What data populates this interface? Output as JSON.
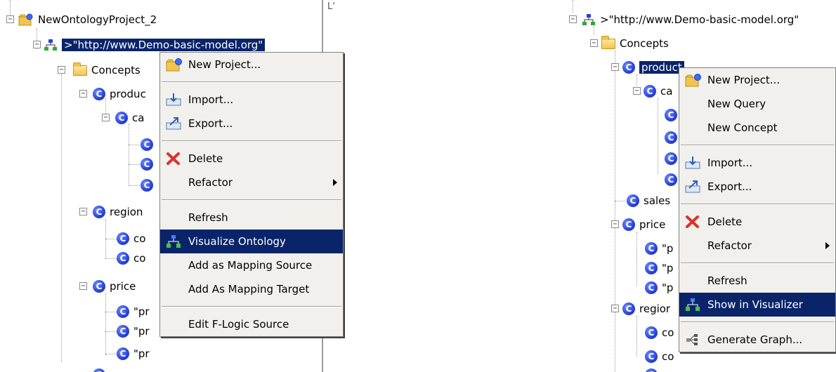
{
  "left": {
    "tree": {
      "project": "NewOntologyProject_2",
      "ontology": ">\"http://www.Demo-basic-model.org\"",
      "concepts": "Concepts",
      "items": [
        "produc",
        "ca",
        "region",
        "co",
        "co",
        "price",
        "\"pr",
        "\"pr",
        "\"pr"
      ]
    },
    "side_label": "L‘",
    "menu": {
      "new_project": "New Project...",
      "import": "Import...",
      "export": "Export...",
      "delete": "Delete",
      "refactor": "Refactor",
      "refresh": "Refresh",
      "visualize": "Visualize Ontology",
      "add_source": "Add as Mapping Source",
      "add_target": "Add As Mapping Target",
      "edit_flogic": "Edit F-Logic Source"
    }
  },
  "right": {
    "tree": {
      "ontology": ">\"http://www.Demo-basic-model.org\"",
      "concepts": "Concepts",
      "product": "product",
      "items": [
        "ca",
        "sales",
        "price",
        "\"p",
        "\"p",
        "\"p",
        "regior",
        "co",
        "co"
      ]
    },
    "menu": {
      "new_project": "New Project...",
      "new_query": "New Query",
      "new_concept": "New Concept",
      "import": "Import...",
      "export": "Export...",
      "delete": "Delete",
      "refactor": "Refactor",
      "refresh": "Refresh",
      "show_visualizer": "Show in Visualizer",
      "generate_graph": "Generate Graph..."
    }
  },
  "colors": {
    "selection": "#0a246a",
    "menu_bg": "#f1f0ec",
    "concept_icon": "#2743d8"
  },
  "icons": [
    "project-icon",
    "ontology-icon",
    "folder-icon",
    "concept-icon",
    "import-icon",
    "export-icon",
    "delete-icon",
    "visualize-icon",
    "graph-icon"
  ]
}
